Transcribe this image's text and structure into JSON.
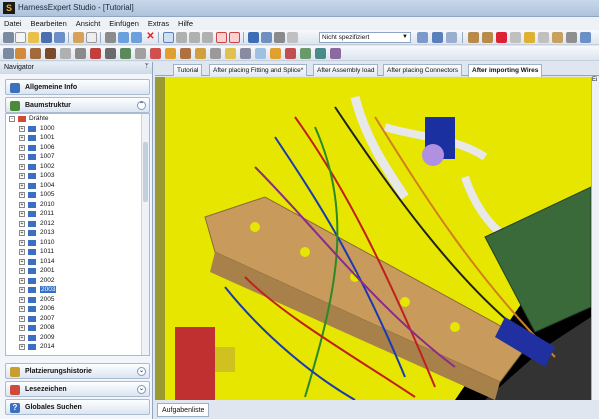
{
  "window": {
    "title": "HarnessExpert Studio - [Tutorial]",
    "app_icon": "app-logo-icon"
  },
  "menu": [
    "Datei",
    "Bearbeiten",
    "Ansicht",
    "Einfügen",
    "Extras",
    "Hilfe"
  ],
  "toolbar": {
    "combo_value": "Nicht spezifiziert"
  },
  "navigator": {
    "title": "Navigator",
    "panels": {
      "info": "Allgemeine Info",
      "structure": "Baumstruktur",
      "history": "Platzierungshistorie",
      "bookmarks": "Lesezeichen",
      "search": "Globales Suchen"
    },
    "tree_root": "Drähte",
    "wires": [
      "1000",
      "1001",
      "1006",
      "1007",
      "1002",
      "1003",
      "1004",
      "1005",
      "2010",
      "2011",
      "2012",
      "2013",
      "1010",
      "1011",
      "1014",
      "2001",
      "2002",
      "2003",
      "2005",
      "2006",
      "2007",
      "2008",
      "2009",
      "2014"
    ],
    "selected_wire": "2003"
  },
  "tabs": [
    "Tutorial",
    "After placing Fitting and Splice*",
    "After Assembly load",
    "After placing Connectors",
    "After importing Wires"
  ],
  "active_tab": "After importing Wires",
  "right_strip_label": "Ei",
  "bottom_tab": "Aufgabenliste",
  "colors": {
    "floor": "#e6e600",
    "board": "#c89a5c",
    "background": "#000000",
    "accent": "#3470c7"
  }
}
